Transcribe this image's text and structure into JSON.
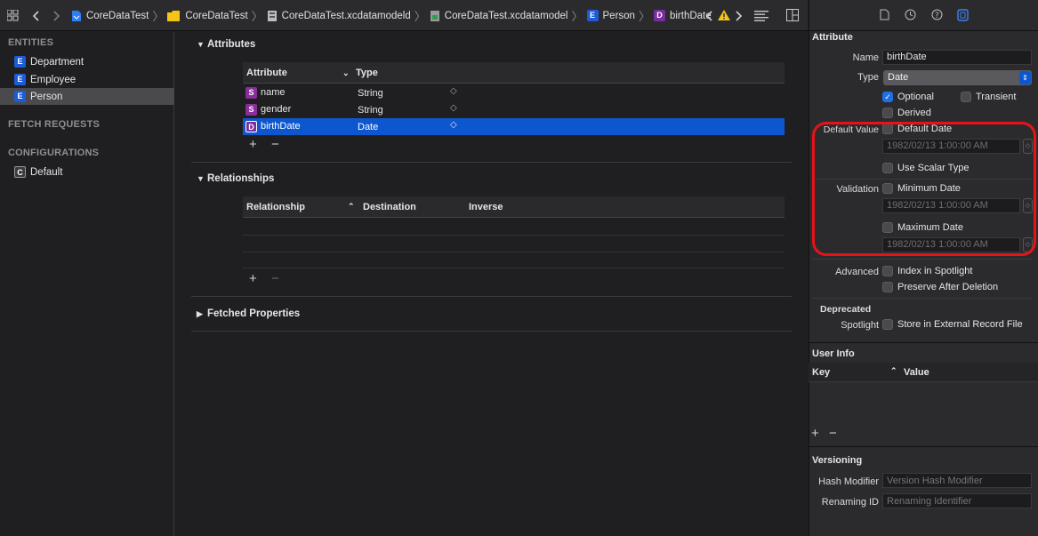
{
  "toolbar": {
    "grid_icon": "grid-icon",
    "back_icon": "chevron-left-icon",
    "forward_icon": "chevron-right-icon",
    "breadcrumbs": [
      {
        "label": "CoreDataTest",
        "icon": "project-file-icon"
      },
      {
        "label": "CoreDataTest",
        "icon": "folder-icon"
      },
      {
        "label": "CoreDataTest.xcdatamodeld",
        "icon": "model-bundle-icon"
      },
      {
        "label": "CoreDataTest.xcdatamodel",
        "icon": "model-file-icon"
      },
      {
        "label": "Person",
        "icon": "entity-icon",
        "badge": "E"
      },
      {
        "label": "birthDate",
        "icon": "date-attribute-icon",
        "badge": "D"
      }
    ]
  },
  "sidebar": {
    "entities_header": "ENTITIES",
    "entities": [
      {
        "badge": "E",
        "label": "Department"
      },
      {
        "badge": "E",
        "label": "Employee"
      },
      {
        "badge": "E",
        "label": "Person",
        "selected": true
      }
    ],
    "fetch_requests_header": "FETCH REQUESTS",
    "configurations_header": "CONFIGURATIONS",
    "configurations": [
      {
        "badge": "C",
        "label": "Default"
      }
    ]
  },
  "editor": {
    "attributes": {
      "title": "Attributes",
      "col_attribute": "Attribute",
      "col_type": "Type",
      "rows": [
        {
          "badge": "S",
          "name": "name",
          "type": "String"
        },
        {
          "badge": "S",
          "name": "gender",
          "type": "String"
        },
        {
          "badge": "D",
          "name": "birthDate",
          "type": "Date",
          "selected": true
        }
      ]
    },
    "relationships": {
      "title": "Relationships",
      "col_relationship": "Relationship",
      "col_destination": "Destination",
      "col_inverse": "Inverse"
    },
    "fetched_properties": {
      "title": "Fetched Properties"
    },
    "add_symbol": "+",
    "remove_symbol": "−"
  },
  "inspector": {
    "section_title": "Attribute",
    "name_label": "Name",
    "name_value": "birthDate",
    "type_label": "Type",
    "type_value": "Date",
    "optional_label": "Optional",
    "optional_checked": true,
    "transient_label": "Transient",
    "derived_label": "Derived",
    "default_value_label": "Default Value",
    "default_date_label": "Default Date",
    "default_date_value": "1982/02/13   1:00:00 AM",
    "use_scalar_label": "Use Scalar Type",
    "validation_label": "Validation",
    "minimum_date_label": "Minimum Date",
    "minimum_date_value": "1982/02/13   1:00:00 AM",
    "maximum_date_label": "Maximum Date",
    "maximum_date_value": "1982/02/13   1:00:00 AM",
    "advanced_label": "Advanced",
    "index_spotlight_label": "Index in Spotlight",
    "preserve_label": "Preserve After Deletion",
    "deprecated_label": "Deprecated",
    "spotlight_label": "Spotlight",
    "external_record_label": "Store in External Record File",
    "user_info_title": "User Info",
    "key_col": "Key",
    "value_col": "Value",
    "versioning_title": "Versioning",
    "hash_modifier_label": "Hash Modifier",
    "hash_modifier_placeholder": "Version Hash Modifier",
    "renaming_id_label": "Renaming ID",
    "renaming_id_placeholder": "Renaming Identifier",
    "highlight_color": "#e4141a"
  }
}
